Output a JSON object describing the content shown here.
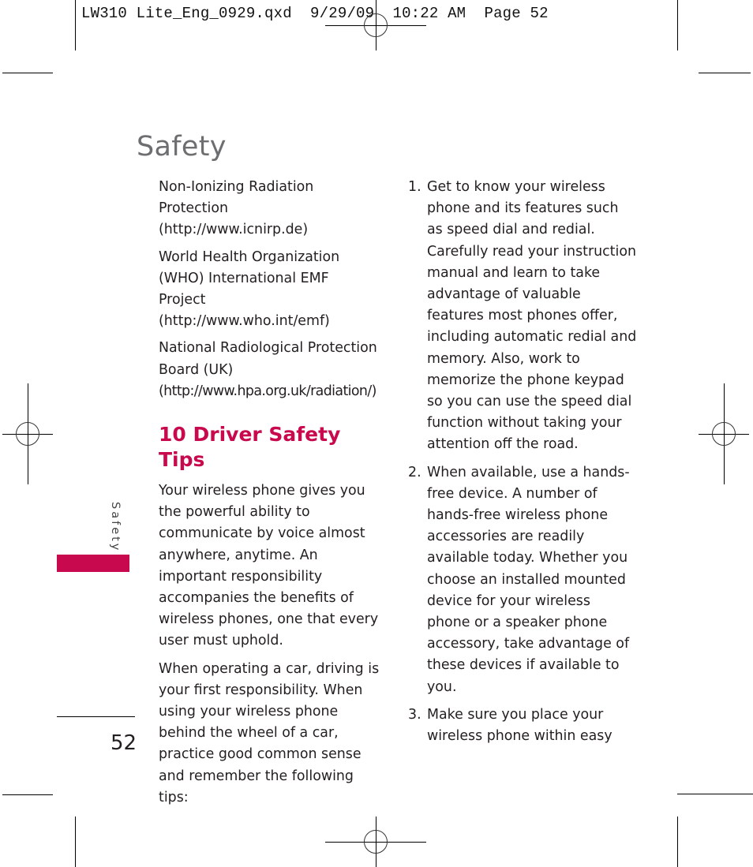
{
  "slug_line": "LW310 Lite_Eng_0929.qxd  9/29/09  10:22 AM  Page 52",
  "page_title": "Safety",
  "side_tab": {
    "label": "Safety",
    "color": "#c8094d"
  },
  "page_number": "52",
  "accent_color": "#c8094d",
  "left_column": {
    "organizations": [
      {
        "lines": [
          "Non-Ionizing Radiation",
          "Protection",
          "(http://www.icnirp.de)"
        ]
      },
      {
        "lines": [
          "World Health Organization",
          "(WHO) International EMF",
          "Project",
          "(http://www.who.int/emf)"
        ]
      },
      {
        "lines": [
          "National Radiological Protection",
          "Board (UK)",
          "(http://www.hpa.org.uk/radiation/)"
        ]
      }
    ],
    "section_heading": "10 Driver Safety Tips",
    "paragraphs": [
      "Your wireless phone gives you the powerful ability to communicate by voice almost anywhere, anytime. An important responsibility accompanies the benefits of wireless phones, one that every user must uphold.",
      "When operating a car, driving is your first responsibility. When using your wireless phone behind the wheel of a car, practice good common sense and remember the following tips:"
    ]
  },
  "right_column": {
    "tips": [
      {
        "number": "1.",
        "text": "Get to know your wireless phone and its features such as speed dial and redial. Carefully read your instruction manual and learn to take advantage of valuable features most phones offer, including automatic redial and memory. Also, work to memorize the phone keypad so you can use the speed dial function without taking your attention off the road."
      },
      {
        "number": "2.",
        "text": "When available, use a hands-free device. A number of hands-free wireless phone accessories are readily available today. Whether you choose an installed mounted device for your wireless phone or a speaker phone accessory, take advantage of these devices if available to you."
      },
      {
        "number": "3.",
        "text": "Make sure you place your wireless phone within easy"
      }
    ]
  }
}
